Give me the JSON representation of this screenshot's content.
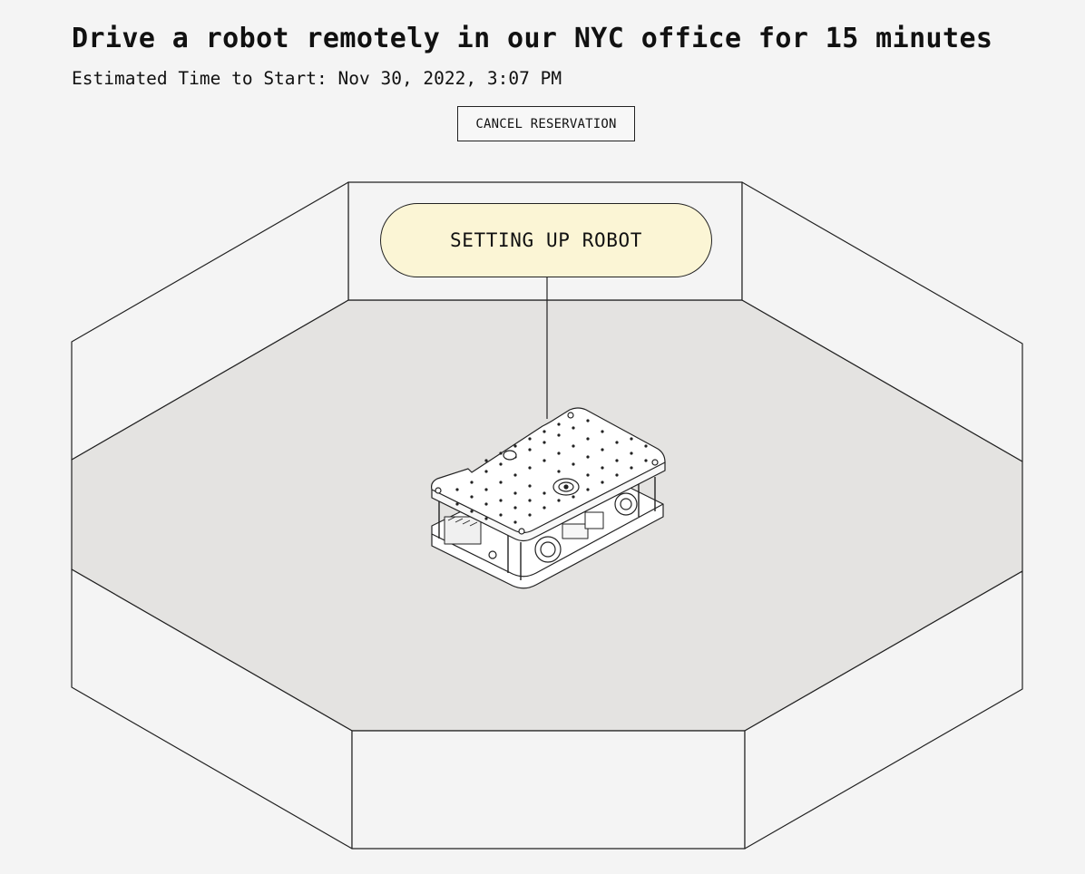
{
  "header": {
    "title": "Drive a robot remotely in our NYC office for 15 minutes",
    "start_prefix": "Estimated Time to Start:",
    "start_time": "Nov 30, 2022, 3:07 PM"
  },
  "actions": {
    "cancel_label": "CANCEL RESERVATION"
  },
  "scene": {
    "status_label": "SETTING UP ROBOT",
    "colors": {
      "background": "#f4f4f4",
      "floor": "#e4e3e1",
      "status_fill": "#fbf5d5",
      "line": "#222222"
    }
  }
}
